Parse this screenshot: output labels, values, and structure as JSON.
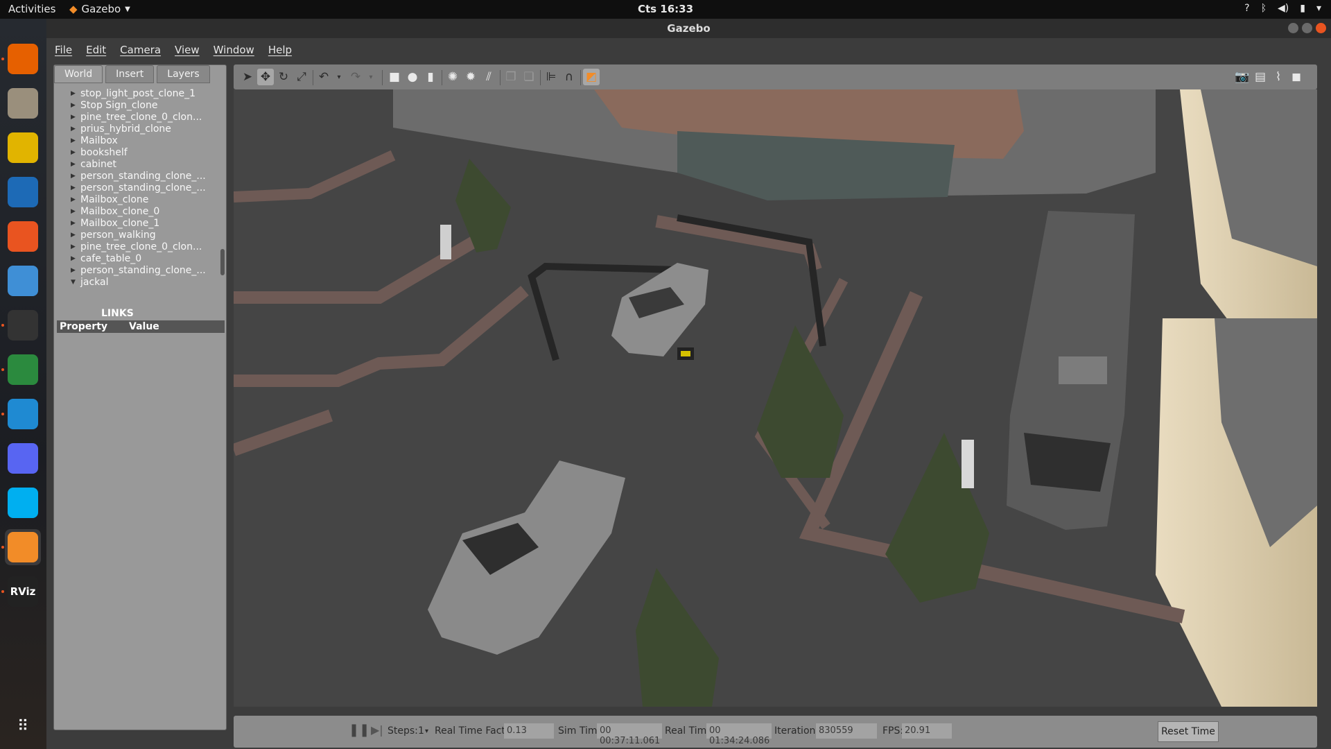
{
  "topbar": {
    "activities": "Activities",
    "app_name": "Gazebo",
    "clock": "Cts 16:33",
    "tray_icons": [
      "help-icon",
      "bluetooth-icon",
      "volume-icon",
      "battery-icon",
      "system-menu-icon"
    ]
  },
  "dock": {
    "items": [
      {
        "name": "firefox",
        "icon": "firefox-icon",
        "color": "#e66000"
      },
      {
        "name": "files",
        "icon": "file-manager-icon",
        "color": "#9a8f7c"
      },
      {
        "name": "rhythmbox",
        "icon": "audio-player-icon",
        "color": "#e1b400"
      },
      {
        "name": "writer",
        "icon": "document-icon",
        "color": "#1d6ab6"
      },
      {
        "name": "software",
        "icon": "app-store-icon",
        "color": "#e95420"
      },
      {
        "name": "help",
        "icon": "help-icon",
        "color": "#3f8fd6"
      },
      {
        "name": "terminal",
        "icon": "terminal-icon",
        "color": "#333333"
      },
      {
        "name": "chrome",
        "icon": "chrome-icon",
        "color": "#2b8a3e"
      },
      {
        "name": "vscode",
        "icon": "vscode-icon",
        "color": "#1f8ad2"
      },
      {
        "name": "discord",
        "icon": "discord-icon",
        "color": "#5865f2"
      },
      {
        "name": "skype",
        "icon": "skype-icon",
        "color": "#00aff0"
      },
      {
        "name": "gazebo",
        "icon": "gazebo-icon",
        "color": "#f28c28"
      },
      {
        "name": "rviz",
        "icon": "rviz-icon",
        "label": "RViz",
        "color": "#222222"
      }
    ],
    "apps_icon": "show-applications-icon"
  },
  "window": {
    "title": "Gazebo"
  },
  "menubar": {
    "items": [
      "File",
      "Edit",
      "Camera",
      "View",
      "Window",
      "Help"
    ]
  },
  "left_panel": {
    "tabs": [
      "World",
      "Insert",
      "Layers"
    ],
    "active_tab": "World",
    "tree": [
      "stop_light_post_clone_1",
      "Stop Sign_clone",
      "pine_tree_clone_0_clon...",
      "prius_hybrid_clone",
      "Mailbox",
      "bookshelf",
      "cabinet",
      "person_standing_clone_...",
      "person_standing_clone_...",
      "Mailbox_clone",
      "Mailbox_clone_0",
      "Mailbox_clone_1",
      "person_walking",
      "pine_tree_clone_0_clon...",
      "cafe_table_0",
      "person_standing_clone_...",
      "jackal"
    ],
    "links_label": "LINKS",
    "property_header": {
      "property": "Property",
      "value": "Value"
    }
  },
  "toolbar": {
    "tools": [
      "select-icon",
      "translate-icon",
      "rotate-icon",
      "scale-icon",
      "undo-icon",
      "undo-dropdown-icon",
      "redo-icon",
      "redo-dropdown-icon",
      "box-icon",
      "sphere-icon",
      "cylinder-icon",
      "point-light-icon",
      "spot-light-icon",
      "directional-light-icon",
      "copy-icon",
      "paste-icon",
      "align-icon",
      "snap-icon",
      "view-angle-icon"
    ],
    "right_tools": [
      "screenshot-icon",
      "log-icon",
      "plot-icon",
      "record-icon"
    ]
  },
  "statusbar": {
    "pause_icon": "pause-icon",
    "step_icon": "step-icon",
    "steps_label": "Steps:",
    "steps_value": "1",
    "rtf_label": "Real Time Factor:",
    "rtf_value": "0.13",
    "sim_time_label": "Sim Time:",
    "sim_time_value": "00 00:37:11.061",
    "real_time_label": "Real Time:",
    "real_time_value": "00 01:34:24.086",
    "iterations_label": "Iterations:",
    "iterations_value": "830559",
    "fps_label": "FPS:",
    "fps_value": "20.91",
    "reset_label": "Reset Time"
  },
  "colors": {
    "accent": "#e95420",
    "ground": "#444444",
    "sidewalk": "#6e5a55",
    "panel": "#999999"
  }
}
